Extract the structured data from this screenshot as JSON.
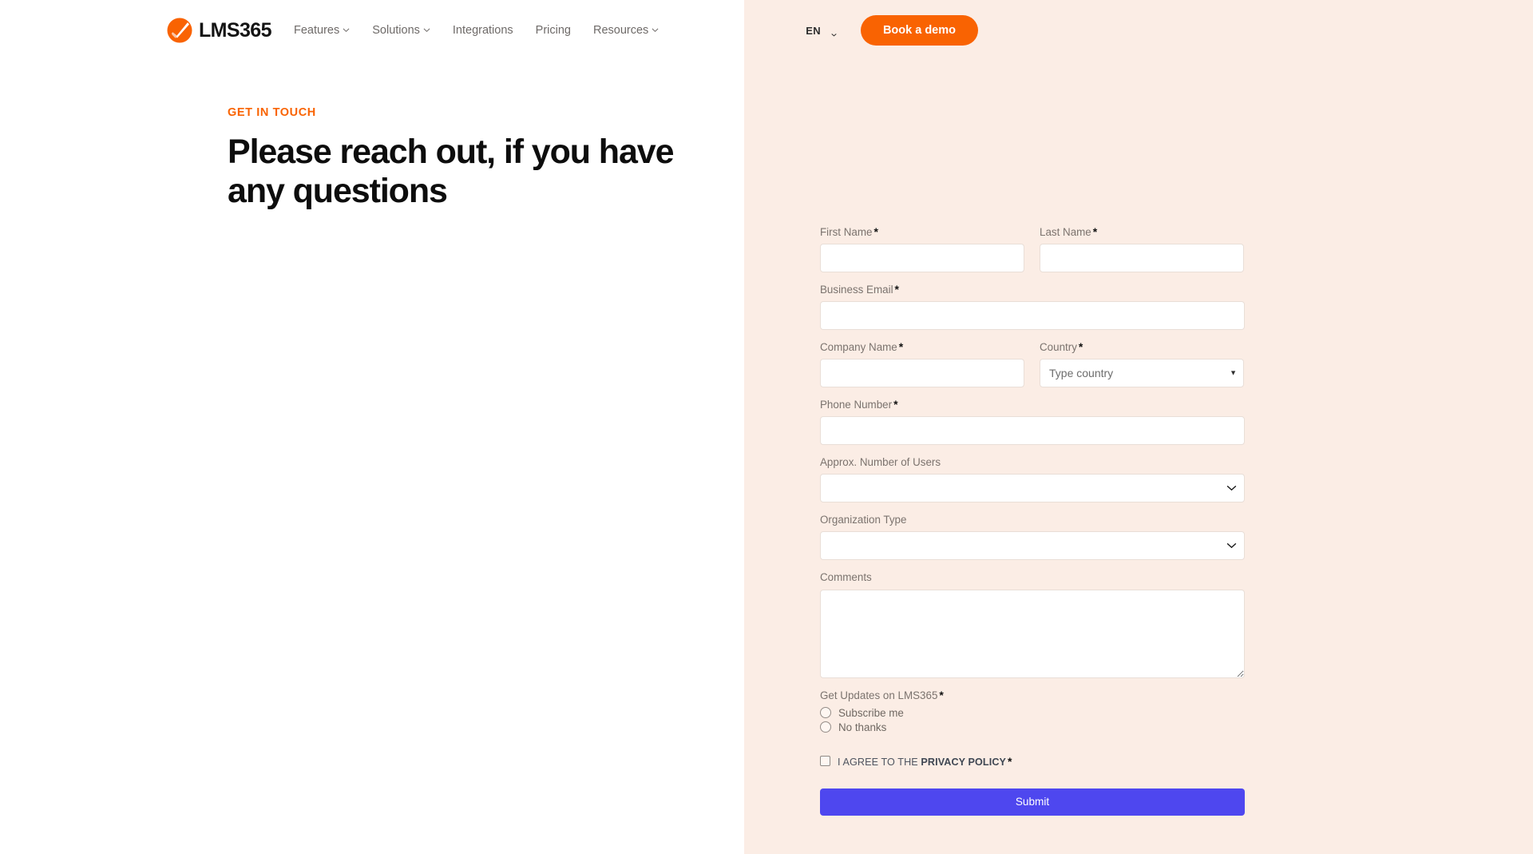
{
  "brand": {
    "logo_text": "LMS365",
    "accent_color": "#f96302",
    "background_right": "#fbede5",
    "submit_color": "#4e47ef"
  },
  "header": {
    "nav": [
      {
        "label": "Features",
        "has_caret": true
      },
      {
        "label": "Solutions",
        "has_caret": true
      },
      {
        "label": "Integrations",
        "has_caret": false
      },
      {
        "label": "Pricing",
        "has_caret": false
      },
      {
        "label": "Resources",
        "has_caret": true
      }
    ],
    "language": "EN",
    "cta_label": "Book a demo"
  },
  "hero": {
    "eyebrow": "GET IN TOUCH",
    "title": "Please reach out, if you have any questions"
  },
  "form": {
    "first_name": {
      "label": "First Name",
      "required": "*",
      "value": "",
      "placeholder": ""
    },
    "last_name": {
      "label": "Last Name",
      "required": "*",
      "value": "",
      "placeholder": ""
    },
    "business_email": {
      "label": "Business Email",
      "required": "*",
      "value": "",
      "placeholder": ""
    },
    "company_name": {
      "label": "Company Name",
      "required": "*",
      "value": "",
      "placeholder": ""
    },
    "country": {
      "label": "Country",
      "required": "*",
      "value": "",
      "placeholder": "Type country",
      "arrow": "▼"
    },
    "phone_number": {
      "label": "Phone Number",
      "required": "*",
      "value": "",
      "placeholder": ""
    },
    "number_of_users": {
      "label": "Approx. Number of Users",
      "required": "",
      "value": "",
      "options": [
        ""
      ]
    },
    "organization_type": {
      "label": "Organization Type",
      "required": "",
      "value": "",
      "options": [
        ""
      ]
    },
    "comments": {
      "label": "Comments",
      "required": "",
      "value": "",
      "placeholder": ""
    },
    "updates": {
      "label": "Get Updates on LMS365",
      "required": "*",
      "options": [
        {
          "label": "Subscribe me",
          "checked": false
        },
        {
          "label": "No thanks",
          "checked": false
        }
      ]
    },
    "privacy": {
      "prefix": "I AGREE TO THE",
      "link": "PRIVACY POLICY",
      "required": "*",
      "checked": false
    },
    "submit_label": "Submit"
  }
}
